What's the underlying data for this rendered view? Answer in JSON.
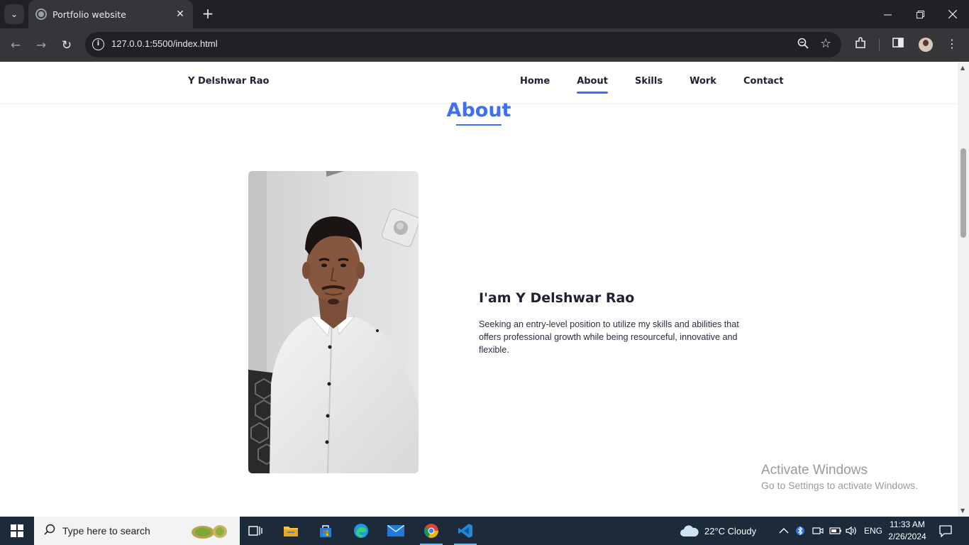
{
  "browser": {
    "tab_title": "Portfolio website",
    "url": "127.0.0.1:5500/index.html"
  },
  "site": {
    "logo": "Y Delshwar Rao",
    "nav": [
      {
        "label": "Home"
      },
      {
        "label": "About",
        "active": true
      },
      {
        "label": "Skills"
      },
      {
        "label": "Work"
      },
      {
        "label": "Contact"
      }
    ],
    "accent_color": "#3e6ff4",
    "about": {
      "section_title": "About",
      "heading": "I'am Y Delshwar Rao",
      "text": "Seeking an entry-level position to utilize my skills and abilities that offers professional growth while being resourceful, innovative and flexible."
    }
  },
  "watermark": {
    "line1": "Activate Windows",
    "line2": "Go to Settings to activate Windows."
  },
  "taskbar": {
    "search_placeholder": "Type here to search",
    "weather": "22°C  Cloudy",
    "language": "ENG",
    "time": "11:33 AM",
    "date": "2/26/2024",
    "apps": [
      "task-view-icon",
      "file-explorer-icon",
      "microsoft-store-icon",
      "edge-icon",
      "mail-icon",
      "chrome-icon",
      "vscode-icon"
    ]
  }
}
